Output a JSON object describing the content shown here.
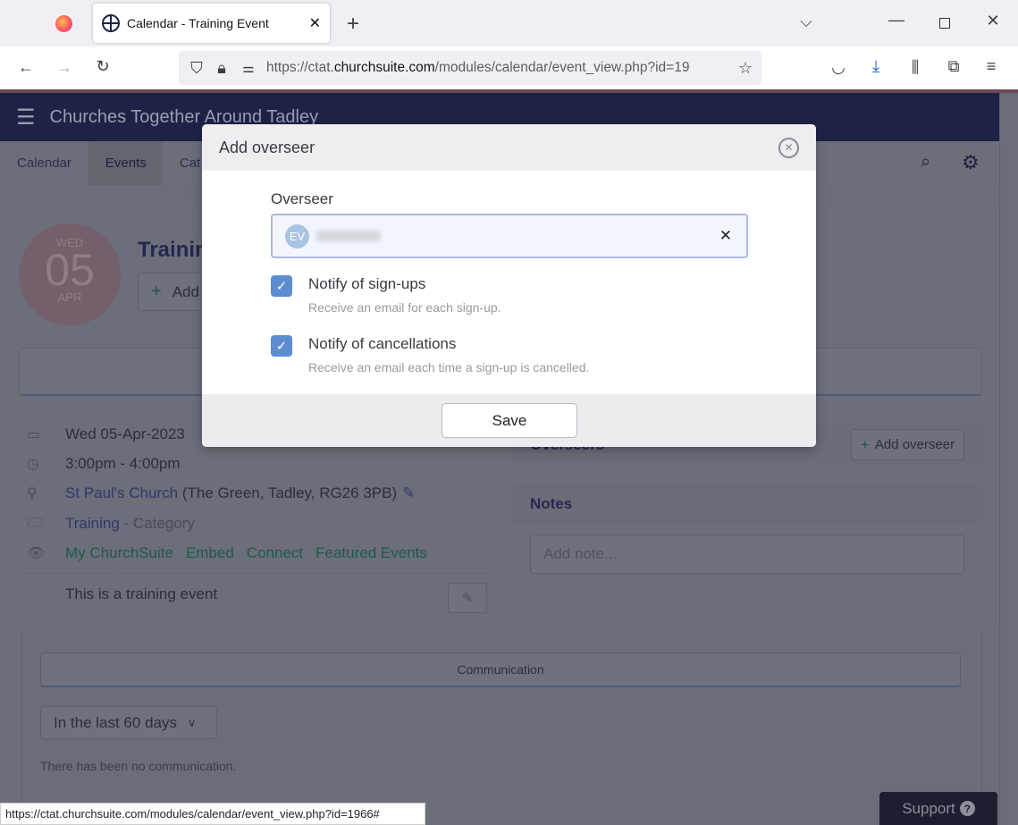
{
  "browser": {
    "tab_title": "Calendar - Training Event",
    "url_prefix": "https://ctat.",
    "url_domain": "churchsuite.com",
    "url_path": "/modules/calendar/event_view.php?id=19",
    "status_url": "https://ctat.churchsuite.com/modules/calendar/event_view.php?id=1966#"
  },
  "app": {
    "title": "Churches Together Around Tadley",
    "nav": [
      "Calendar",
      "Events",
      "Cat"
    ]
  },
  "event": {
    "day_name": "WED",
    "day": "05",
    "month": "APR",
    "title": "Trainin",
    "add_label": "Add",
    "date": "Wed 05-Apr-2023",
    "time": "3:00pm - 4:00pm",
    "location_link": "St Paul's Church",
    "location_address": "(The Green, Tadley, RG26 3PB)",
    "category": "Training",
    "category_suffix": "- Category",
    "visibility": [
      "My ChurchSuite",
      "Embed",
      "Connect",
      "Featured Events"
    ],
    "description": "This is a training event"
  },
  "side": {
    "overseers_title": "Overseers",
    "add_overseer": "Add overseer",
    "notes_title": "Notes",
    "note_placeholder": "Add note..."
  },
  "communication": {
    "tab": "Communication",
    "filter": "In the last 60 days",
    "empty": "There has been no communication."
  },
  "support": "Support",
  "modal": {
    "title": "Add overseer",
    "field_label": "Overseer",
    "avatar_initials": "EV",
    "options": [
      {
        "label": "Notify of sign-ups",
        "help": "Receive an email for each sign-up.",
        "checked": true
      },
      {
        "label": "Notify of cancellations",
        "help": "Receive an email each time a sign-up is cancelled.",
        "checked": true
      }
    ],
    "save": "Save"
  }
}
